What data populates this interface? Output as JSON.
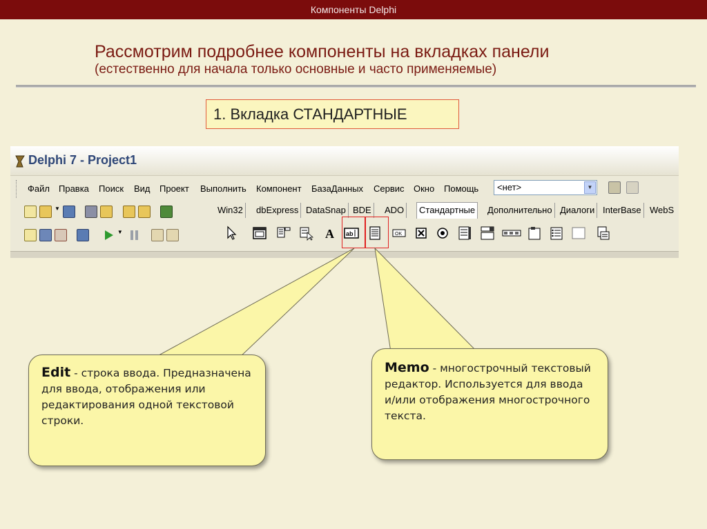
{
  "header": {
    "title": "Компоненты Delphi"
  },
  "slide": {
    "title": "Рассмотрим подробнее компоненты на вкладках панели",
    "subtitle": "(естественно для начала только основные и часто применяемые)",
    "tab_label": "1. Вкладка СТАНДАРТНЫЕ"
  },
  "delphi": {
    "window_title": "Delphi 7 - Project1",
    "menu": [
      "Файл",
      "Правка",
      "Поиск",
      "Вид",
      "Проект",
      "Выполнить",
      "Компонент",
      "БазаДанных",
      "Сервис",
      "Окно",
      "Помощь"
    ],
    "combo_value": "<нет>",
    "palette_tabs": [
      "Win32",
      "dbExpress",
      "DataSnap",
      "BDE",
      "ADO",
      "Стандартные",
      "Дополнительно",
      "Диалоги",
      "InterBase",
      "WebS"
    ],
    "active_tab": "Стандартные"
  },
  "callouts": {
    "edit": {
      "keyword": "Edit",
      "text": " - строка ввода. Предназначена для ввода, отображения или редактирования одной текстовой строки."
    },
    "memo": {
      "keyword": "Memo",
      "text": " - многострочный текстовый редактор. Используется для ввода и/или отображения многострочного текста."
    }
  },
  "colors": {
    "header_bg": "#7b0c0c",
    "slide_bg": "#f4f0d8",
    "bubble_bg": "#fbf6a8",
    "highlight": "#e02020",
    "title_text": "#7a1a12"
  }
}
